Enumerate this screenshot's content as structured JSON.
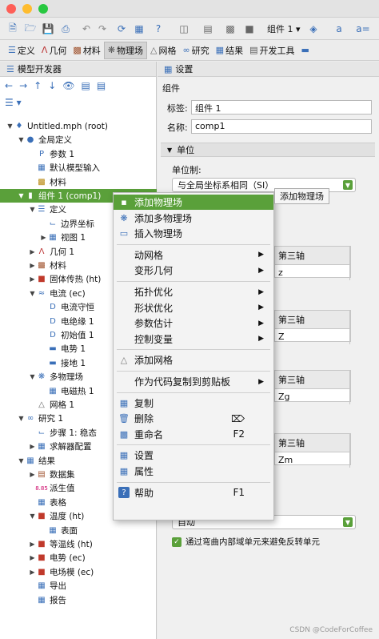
{
  "toolbar_top": {
    "component_label": "组件 1"
  },
  "tabs": [
    {
      "label": "定义",
      "icon": "definitions-icon"
    },
    {
      "label": "几何",
      "icon": "geometry-icon"
    },
    {
      "label": "材料",
      "icon": "materials-icon"
    },
    {
      "label": "物理场",
      "icon": "physics-icon"
    },
    {
      "label": "网格",
      "icon": "mesh-icon"
    },
    {
      "label": "研究",
      "icon": "study-icon"
    },
    {
      "label": "结果",
      "icon": "results-icon"
    },
    {
      "label": "开发工具",
      "icon": "developer-icon"
    }
  ],
  "left_panel": {
    "title": "模型开发器",
    "tree": [
      {
        "label": "Untitled.mph (root)",
        "depth": 0,
        "expand": "down"
      },
      {
        "label": "全局定义",
        "depth": 1,
        "expand": "down"
      },
      {
        "label": "参数 1",
        "depth": 2,
        "expand": ""
      },
      {
        "label": "默认模型输入",
        "depth": 2,
        "expand": ""
      },
      {
        "label": "材料",
        "depth": 2,
        "expand": ""
      },
      {
        "label": "组件 1 (comp1)",
        "depth": 1,
        "expand": "down",
        "selected": true
      },
      {
        "label": "定义",
        "depth": 2,
        "expand": "down"
      },
      {
        "label": "边界坐标",
        "depth": 3,
        "expand": ""
      },
      {
        "label": "视图 1",
        "depth": 3,
        "expand": "right"
      },
      {
        "label": "几何 1",
        "depth": 2,
        "expand": "right"
      },
      {
        "label": "材料",
        "depth": 2,
        "expand": "right"
      },
      {
        "label": "固体传热 (ht)",
        "depth": 2,
        "expand": "right"
      },
      {
        "label": "电流 (ec)",
        "depth": 2,
        "expand": "down"
      },
      {
        "label": "电流守恒",
        "depth": 3,
        "expand": ""
      },
      {
        "label": "电绝缘 1",
        "depth": 3,
        "expand": ""
      },
      {
        "label": "初始值 1",
        "depth": 3,
        "expand": ""
      },
      {
        "label": "电势 1",
        "depth": 3,
        "expand": ""
      },
      {
        "label": "接地 1",
        "depth": 3,
        "expand": ""
      },
      {
        "label": "多物理场",
        "depth": 2,
        "expand": "down"
      },
      {
        "label": "电磁热 1",
        "depth": 3,
        "expand": ""
      },
      {
        "label": "网格 1",
        "depth": 2,
        "expand": ""
      },
      {
        "label": "研究 1",
        "depth": 1,
        "expand": "down"
      },
      {
        "label": "步骤 1: 稳态",
        "depth": 2,
        "expand": ""
      },
      {
        "label": "求解器配置",
        "depth": 2,
        "expand": "right"
      },
      {
        "label": "结果",
        "depth": 1,
        "expand": "down"
      },
      {
        "label": "数据集",
        "depth": 2,
        "expand": "right"
      },
      {
        "label": "派生值",
        "depth": 2,
        "expand": ""
      },
      {
        "label": "表格",
        "depth": 2,
        "expand": ""
      },
      {
        "label": "温度 (ht)",
        "depth": 2,
        "expand": "down"
      },
      {
        "label": "表面",
        "depth": 3,
        "expand": ""
      },
      {
        "label": "等温线 (ht)",
        "depth": 2,
        "expand": "right"
      },
      {
        "label": "电势 (ec)",
        "depth": 2,
        "expand": "right"
      },
      {
        "label": "电场模 (ec)",
        "depth": 2,
        "expand": "right"
      },
      {
        "label": "导出",
        "depth": 2,
        "expand": ""
      },
      {
        "label": "报告",
        "depth": 2,
        "expand": ""
      }
    ]
  },
  "right_panel": {
    "title": "设置",
    "subtitle": "组件",
    "label_key": "标签:",
    "label_value": "组件 1",
    "name_key": "名称:",
    "name_value": "comp1",
    "unit_section": "单位",
    "unit_system_label": "单位制:",
    "unit_system_value": "与全局坐标系相同（SI）",
    "add_physics_tooltip": "添加物理场",
    "axis3_header": "第三轴",
    "axis_values": [
      "z",
      "Z",
      "Zg",
      "Zm"
    ],
    "auto_value": "自动",
    "checkbox_label": "通过弯曲内部域单元来避免反转单元"
  },
  "context_menu": {
    "items": [
      {
        "label": "添加物理场",
        "icon": "add-physics-icon",
        "highlight": true
      },
      {
        "label": "添加多物理场",
        "icon": "add-multiphysics-icon"
      },
      {
        "label": "插入物理场",
        "icon": "insert-physics-icon"
      },
      {
        "sep": true
      },
      {
        "label": "动网格",
        "submenu": true
      },
      {
        "label": "变形几何",
        "submenu": true
      },
      {
        "sep": true
      },
      {
        "label": "拓扑优化",
        "submenu": true
      },
      {
        "label": "形状优化",
        "submenu": true
      },
      {
        "label": "参数估计",
        "submenu": true
      },
      {
        "label": "控制变量",
        "submenu": true
      },
      {
        "sep": true
      },
      {
        "label": "添加网格",
        "icon": "add-mesh-icon"
      },
      {
        "sep": true
      },
      {
        "label": "作为代码复制到剪贴板",
        "submenu": true
      },
      {
        "sep": true
      },
      {
        "label": "复制",
        "icon": "copy-icon"
      },
      {
        "label": "删除",
        "icon": "delete-icon",
        "shortcut_icon": "delete-key-icon"
      },
      {
        "label": "重命名",
        "icon": "rename-icon",
        "shortcut": "F2"
      },
      {
        "sep": true
      },
      {
        "label": "设置",
        "icon": "settings-icon"
      },
      {
        "label": "属性",
        "icon": "properties-icon"
      },
      {
        "sep": true
      },
      {
        "label": "帮助",
        "icon": "help-icon",
        "shortcut": "F1"
      }
    ]
  },
  "watermark": "CSDN @CodeForCoffee"
}
